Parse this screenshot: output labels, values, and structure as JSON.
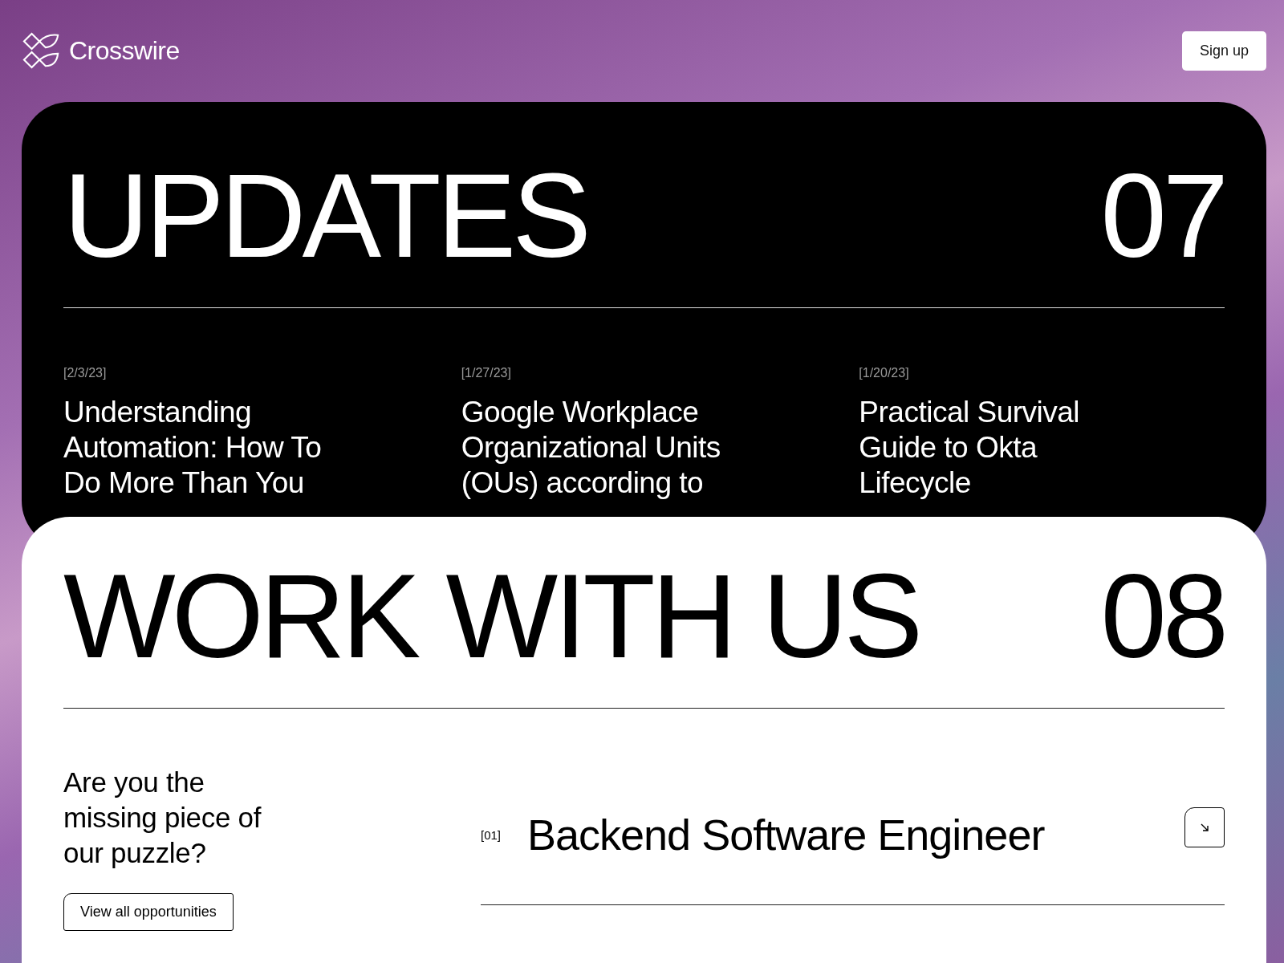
{
  "header": {
    "brand": "Crosswire",
    "signup": "Sign up"
  },
  "updates": {
    "title": "UPDATES",
    "number": "07",
    "posts": [
      {
        "date": "[2/3/23]",
        "title": "Understanding Automation: How To Do More Than You"
      },
      {
        "date": "[1/27/23]",
        "title": "Google Workplace Organizational Units (OUs) according to"
      },
      {
        "date": "[1/20/23]",
        "title": "Practical Survival Guide to Okta Lifecycle"
      }
    ]
  },
  "work": {
    "title": "WORK WITH US",
    "number": "08",
    "tagline": "Are you the missing piece of our puzzle?",
    "button": "View all opportunities",
    "jobs": [
      {
        "index": "[01]",
        "title": "Backend Software Engineer"
      }
    ]
  }
}
